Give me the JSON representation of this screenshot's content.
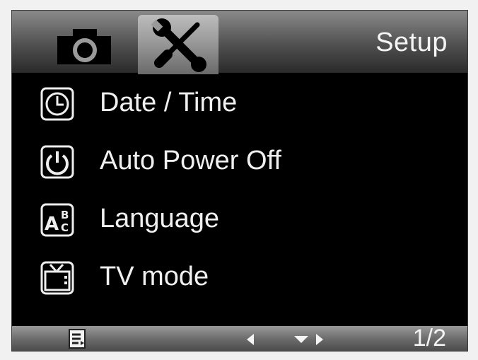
{
  "header": {
    "title": "Setup",
    "tabs": [
      {
        "icon": "camera-icon"
      },
      {
        "icon": "wrench-screwdriver-icon"
      }
    ]
  },
  "menu": {
    "items": [
      {
        "label": "Date / Time",
        "icon": "clock-icon"
      },
      {
        "label": "Auto Power Off",
        "icon": "power-icon"
      },
      {
        "label": "Language",
        "icon": "language-abc-icon"
      },
      {
        "label": "TV mode",
        "icon": "tv-icon"
      }
    ]
  },
  "footer": {
    "page_indicator": "1/2",
    "icons": [
      "menu-list-icon",
      "left-arrow-icon",
      "down-arrow-icon",
      "right-arrow-icon"
    ]
  }
}
